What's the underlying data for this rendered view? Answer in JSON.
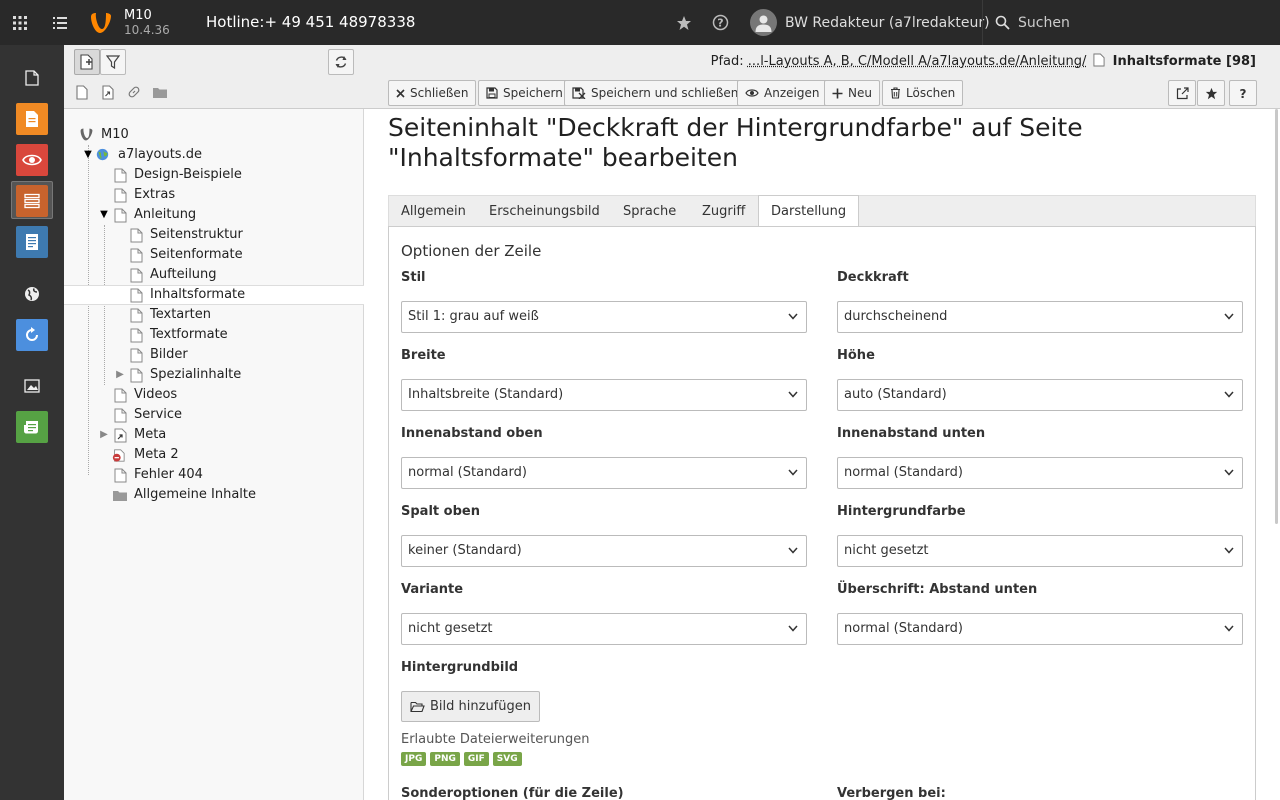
{
  "topbar": {
    "app_title": "M10",
    "version": "10.4.36",
    "hotline": "Hotline:+ 49 451 48978338",
    "user": "BW Redakteur (a7lredakteur)",
    "search_label": "Suchen"
  },
  "tree": {
    "root": "M10",
    "site": "a7layouts.de",
    "nodes": {
      "design": "Design-Beispiele",
      "extras": "Extras",
      "anleitung": "Anleitung",
      "seitenstruktur": "Seitenstruktur",
      "seitenformate": "Seitenformate",
      "aufteilung": "Aufteilung",
      "inhaltsformate": "Inhaltsformate",
      "textarten": "Textarten",
      "textformate": "Textformate",
      "bilder": "Bilder",
      "spezialinhalte": "Spezialinhalte",
      "videos": "Videos",
      "service": "Service",
      "meta": "Meta",
      "meta2": "Meta 2",
      "fehler": "Fehler 404",
      "allgemein": "Allgemeine Inhalte"
    }
  },
  "docheader": {
    "path_label": "Pfad:",
    "path_crumb": "...l-Layouts A, B, C/Modell A/a7layouts.de/Anleitung/",
    "path_current": "Inhaltsformate [98]",
    "buttons": {
      "close": "Schließen",
      "save": "Speichern",
      "save_close": "Speichern und schließen",
      "view": "Anzeigen",
      "new": "Neu",
      "delete": "Löschen"
    }
  },
  "content": {
    "title": "Seiteninhalt \"Deckkraft der Hintergrundfarbe\" auf Seite \"Inhaltsformate\" bearbeiten",
    "tabs": [
      "Allgemein",
      "Erscheinungsbild",
      "Sprache",
      "Zugriff",
      "Darstellung"
    ],
    "section_title": "Optionen der Zeile",
    "fields": {
      "stil": {
        "label": "Stil",
        "value": "Stil 1: grau auf weiß"
      },
      "deckkraft": {
        "label": "Deckkraft",
        "value": "durchscheinend"
      },
      "breite": {
        "label": "Breite",
        "value": "Inhaltsbreite (Standard)"
      },
      "hoehe": {
        "label": "Höhe",
        "value": "auto (Standard)"
      },
      "innen_oben": {
        "label": "Innenabstand oben",
        "value": "normal (Standard)"
      },
      "innen_unten": {
        "label": "Innenabstand unten",
        "value": "normal (Standard)"
      },
      "spalt_oben": {
        "label": "Spalt oben",
        "value": "keiner (Standard)"
      },
      "hintergrundfarbe": {
        "label": "Hintergrundfarbe",
        "value": "nicht gesetzt"
      },
      "variante": {
        "label": "Variante",
        "value": "nicht gesetzt"
      },
      "ueberschrift": {
        "label": "Überschrift: Abstand unten",
        "value": "normal (Standard)"
      }
    },
    "bg_image_label": "Hintergrundbild",
    "add_image_button": "Bild hinzufügen",
    "allowed_label": "Erlaubte Dateierweiterungen",
    "extensions": [
      "JPG",
      "PNG",
      "GIF",
      "SVG"
    ],
    "special_options_label": "Sonderoptionen (für die Zeile)",
    "hide_on_label": "Verbergen bei:"
  },
  "colors": {
    "topbar": "#292929",
    "modmenu": "#333333",
    "typo3_orange": "#ff8700",
    "ext_badge": "#79a548"
  }
}
